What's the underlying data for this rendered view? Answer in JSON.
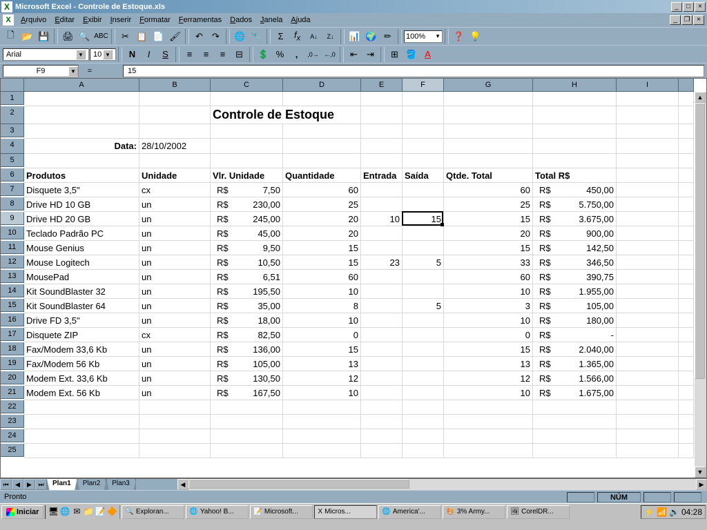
{
  "titlebar": {
    "app": "Microsoft Excel",
    "doc": "Controle de Estoque.xls"
  },
  "menus": [
    "Arquivo",
    "Editar",
    "Exibir",
    "Inserir",
    "Formatar",
    "Ferramentas",
    "Dados",
    "Janela",
    "Ajuda"
  ],
  "menu_keys": [
    "A",
    "E",
    "E",
    "I",
    "F",
    "F",
    "D",
    "J",
    "A"
  ],
  "format": {
    "font": "Arial",
    "size": "10"
  },
  "zoom": "100%",
  "namebox": "F9",
  "formula": "15",
  "columns": [
    "A",
    "B",
    "C",
    "D",
    "E",
    "F",
    "G",
    "H",
    "I"
  ],
  "rows_visible": 25,
  "active_cell": "F9",
  "sheet": {
    "title": "Controle de Estoque",
    "date_label": "Data:",
    "date_value": "28/10/2002",
    "headers": {
      "produtos": "Produtos",
      "unidade": "Unidade",
      "vlr": "Vlr. Unidade",
      "qtd": "Quantidade",
      "entrada": "Entrada",
      "saida": "Saída",
      "total_qt": "Qtde. Total",
      "total_rs": "Total R$"
    },
    "items": [
      {
        "p": "Disquete 3,5\"",
        "u": "cx",
        "v": "7,50",
        "q": "60",
        "e": "",
        "s": "",
        "t": "60",
        "r": "450,00"
      },
      {
        "p": "Drive HD 10 GB",
        "u": "un",
        "v": "230,00",
        "q": "25",
        "e": "",
        "s": "",
        "t": "25",
        "r": "5.750,00"
      },
      {
        "p": "Drive HD 20 GB",
        "u": "un",
        "v": "245,00",
        "q": "20",
        "e": "10",
        "s": "15",
        "t": "15",
        "r": "3.675,00"
      },
      {
        "p": "Teclado Padrão PC",
        "u": "un",
        "v": "45,00",
        "q": "20",
        "e": "",
        "s": "",
        "t": "20",
        "r": "900,00"
      },
      {
        "p": "Mouse Genius",
        "u": "un",
        "v": "9,50",
        "q": "15",
        "e": "",
        "s": "",
        "t": "15",
        "r": "142,50"
      },
      {
        "p": "Mouse Logitech",
        "u": "un",
        "v": "10,50",
        "q": "15",
        "e": "23",
        "s": "5",
        "t": "33",
        "r": "346,50"
      },
      {
        "p": "MousePad",
        "u": "un",
        "v": "6,51",
        "q": "60",
        "e": "",
        "s": "",
        "t": "60",
        "r": "390,75"
      },
      {
        "p": "Kit SoundBlaster 32",
        "u": "un",
        "v": "195,50",
        "q": "10",
        "e": "",
        "s": "",
        "t": "10",
        "r": "1.955,00"
      },
      {
        "p": "Kit SoundBlaster 64",
        "u": "un",
        "v": "35,00",
        "q": "8",
        "e": "",
        "s": "5",
        "t": "3",
        "r": "105,00"
      },
      {
        "p": "Drive FD 3,5\"",
        "u": "un",
        "v": "18,00",
        "q": "10",
        "e": "",
        "s": "",
        "t": "10",
        "r": "180,00"
      },
      {
        "p": "Disquete ZIP",
        "u": "cx",
        "v": "82,50",
        "q": "0",
        "e": "",
        "s": "",
        "t": "0",
        "r": "-"
      },
      {
        "p": "Fax/Modem 33,6 Kb",
        "u": "un",
        "v": "136,00",
        "q": "15",
        "e": "",
        "s": "",
        "t": "15",
        "r": "2.040,00"
      },
      {
        "p": "Fax/Modem 56 Kb",
        "u": "un",
        "v": "105,00",
        "q": "13",
        "e": "",
        "s": "",
        "t": "13",
        "r": "1.365,00"
      },
      {
        "p": "Modem Ext. 33,6 Kb",
        "u": "un",
        "v": "130,50",
        "q": "12",
        "e": "",
        "s": "",
        "t": "12",
        "r": "1.566,00"
      },
      {
        "p": "Modem Ext. 56 Kb",
        "u": "un",
        "v": "167,50",
        "q": "10",
        "e": "",
        "s": "",
        "t": "10",
        "r": "1.675,00"
      }
    ]
  },
  "sheet_tabs": [
    "Plan1",
    "Plan2",
    "Plan3"
  ],
  "status": {
    "ready": "Pronto",
    "num": "NÚM"
  },
  "taskbar": {
    "start": "Iniciar",
    "tasks": [
      "Exploran...",
      "Yahoo! B...",
      "Microsoft...",
      "Micros...",
      "America'...",
      "3% Army...",
      "CorelDR..."
    ],
    "active_task": 3,
    "clock": "04:28"
  }
}
